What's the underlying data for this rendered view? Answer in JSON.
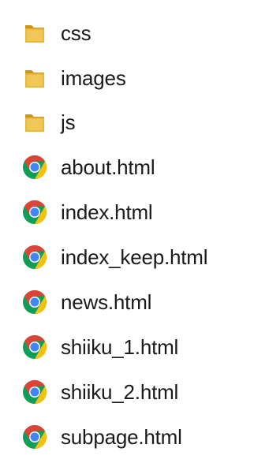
{
  "files": [
    {
      "name": "css",
      "type": "folder",
      "icon": "folder-icon"
    },
    {
      "name": "images",
      "type": "folder",
      "icon": "folder-icon"
    },
    {
      "name": "js",
      "type": "folder",
      "icon": "folder-icon"
    },
    {
      "name": "about.html",
      "type": "html",
      "icon": "chrome-icon"
    },
    {
      "name": "index.html",
      "type": "html",
      "icon": "chrome-icon"
    },
    {
      "name": "index_keep.html",
      "type": "html",
      "icon": "chrome-icon"
    },
    {
      "name": "news.html",
      "type": "html",
      "icon": "chrome-icon"
    },
    {
      "name": "shiiku_1.html",
      "type": "html",
      "icon": "chrome-icon"
    },
    {
      "name": "shiiku_2.html",
      "type": "html",
      "icon": "chrome-icon"
    },
    {
      "name": "subpage.html",
      "type": "html",
      "icon": "chrome-icon"
    }
  ],
  "colors": {
    "folder": "#e8b83a",
    "folder_dark": "#c9961a",
    "chrome_red": "#db4437",
    "chrome_yellow": "#f4c20d",
    "chrome_green": "#0f9d58",
    "chrome_blue": "#4285f4",
    "text": "#1a1a1a"
  }
}
